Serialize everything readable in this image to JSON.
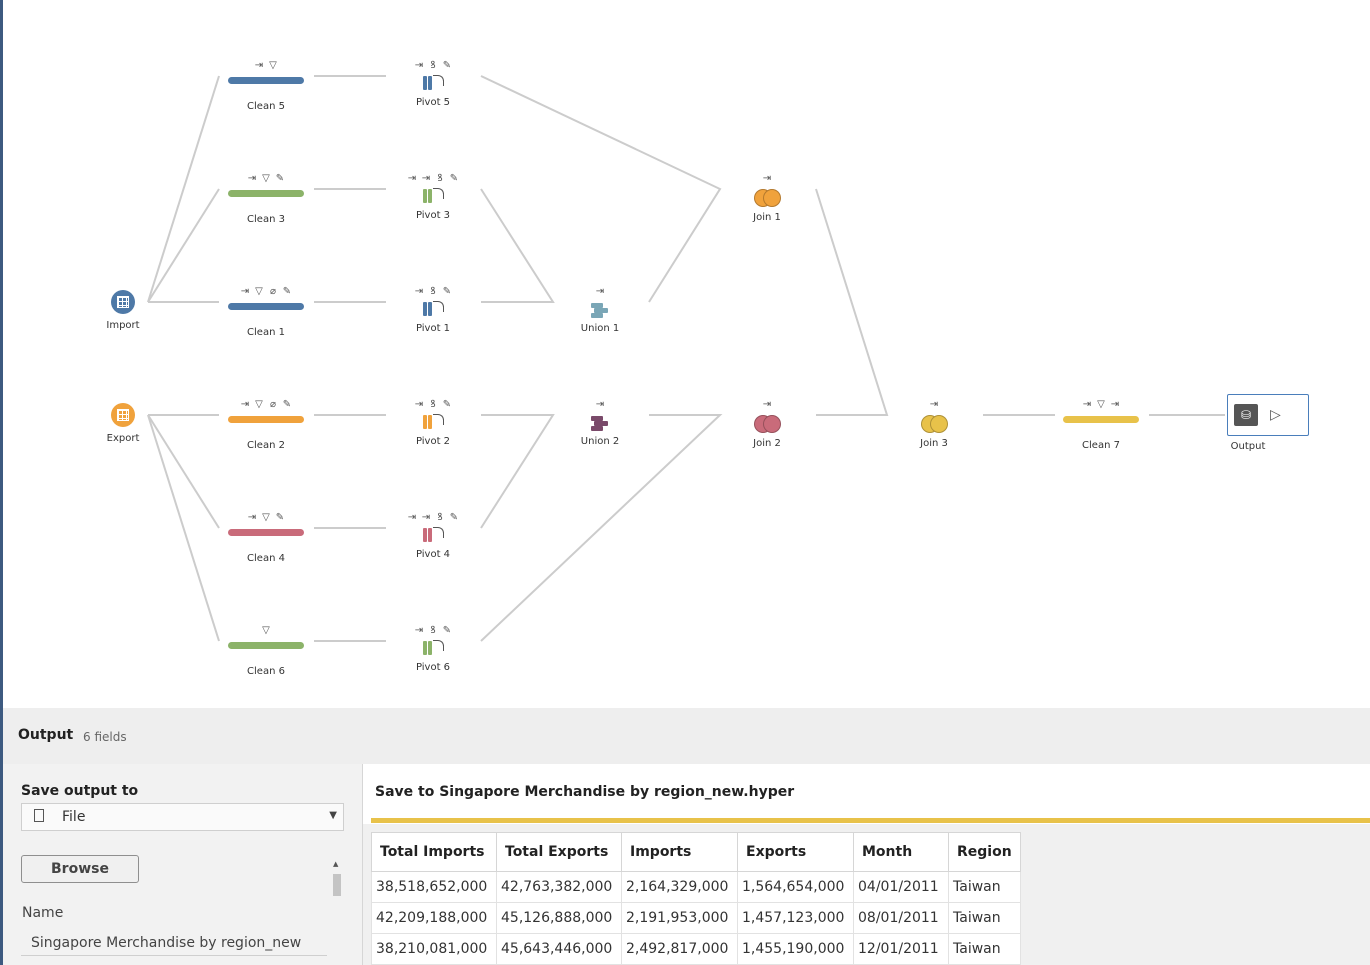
{
  "flow": {
    "nodes": {
      "clean5": {
        "label": "Clean 5",
        "color": "#4e79a7"
      },
      "clean3": {
        "label": "Clean 3",
        "color": "#8cb369"
      },
      "clean1": {
        "label": "Clean 1",
        "color": "#4e79a7"
      },
      "clean2": {
        "label": "Clean 2",
        "color": "#f0a23c"
      },
      "clean4": {
        "label": "Clean 4",
        "color": "#c96b7a"
      },
      "clean6": {
        "label": "Clean 6",
        "color": "#8cb369"
      },
      "clean7": {
        "label": "Clean 7",
        "color": "#e8c24a"
      },
      "pivot5": {
        "label": "Pivot 5"
      },
      "pivot3": {
        "label": "Pivot 3"
      },
      "pivot1": {
        "label": "Pivot 1"
      },
      "pivot2": {
        "label": "Pivot 2"
      },
      "pivot4": {
        "label": "Pivot 4"
      },
      "pivot6": {
        "label": "Pivot 6"
      },
      "import": {
        "label": "Import",
        "color": "#4e79a7"
      },
      "export": {
        "label": "Export",
        "color": "#f0a23c"
      },
      "union1": {
        "label": "Union 1"
      },
      "union2": {
        "label": "Union 2"
      },
      "join1": {
        "label": "Join 1",
        "color": "#f0a23c"
      },
      "join2": {
        "label": "Join 2",
        "color": "#c96b7a"
      },
      "join3": {
        "label": "Join 3",
        "color": "#e8c24a"
      },
      "output": {
        "label": "Output"
      }
    }
  },
  "panel": {
    "title": "Output",
    "fields_count": "6 fields",
    "save_output_label": "Save output to",
    "file_option": "File",
    "browse_label": "Browse",
    "name_label": "Name",
    "name_value": "Singapore Merchandise by region_new",
    "preview_title": "Save to Singapore Merchandise by region_new.hyper"
  },
  "table": {
    "headers": [
      "Total Imports",
      "Total Exports",
      "Imports",
      "Exports",
      "Month",
      "Region"
    ],
    "rows": [
      [
        "38,518,652,000",
        "42,763,382,000",
        "2,164,329,000",
        "1,564,654,000",
        "04/01/2011",
        "Taiwan"
      ],
      [
        "42,209,188,000",
        "45,126,888,000",
        "2,191,953,000",
        "1,457,123,000",
        "08/01/2011",
        "Taiwan"
      ],
      [
        "38,210,081,000",
        "45,643,446,000",
        "2,492,817,000",
        "1,455,190,000",
        "12/01/2011",
        "Taiwan"
      ]
    ]
  }
}
